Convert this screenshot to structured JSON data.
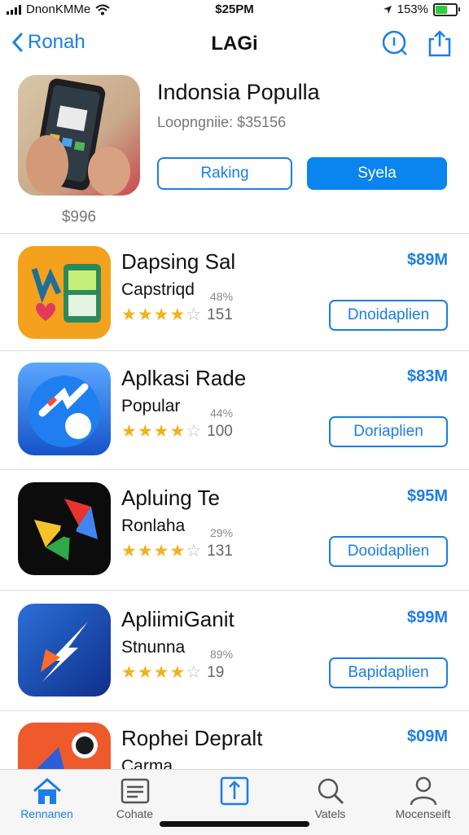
{
  "status": {
    "carrier": "DnonKMMe",
    "time": "$25PM",
    "battery": "153%"
  },
  "nav": {
    "back_label": "Ronah",
    "title": "LAGi"
  },
  "hero": {
    "title": "Indonsia Populla",
    "subtitle": "Loopngniie: $35156",
    "price": "$996",
    "outline_button": "Raking",
    "filled_button": "Syela"
  },
  "apps": [
    {
      "name": "Dapsing Sal",
      "category": "Capstriqd",
      "percent": "48%",
      "rating": 4.5,
      "count": "151",
      "price": "$89M",
      "button": "Dnoidaplien"
    },
    {
      "name": "Aplkasi Rade",
      "category": "Popular",
      "percent": "44%",
      "rating": 4.5,
      "count": "100",
      "price": "$83M",
      "button": "Doriaplien"
    },
    {
      "name": "Apluing Te",
      "category": "Ronlaha",
      "percent": "29%",
      "rating": 4.5,
      "count": "131",
      "price": "$95M",
      "button": "Dooidaplien"
    },
    {
      "name": "ApliimiGanit",
      "category": "Stnunna",
      "percent": "89%",
      "rating": 4.0,
      "count": "19",
      "price": "$99M",
      "button": "Bapidaplien"
    },
    {
      "name": "Rophei Depralt",
      "category": "Carma",
      "price": "$09M"
    }
  ],
  "tabs": [
    {
      "label": "Rennanen",
      "icon": "home-icon"
    },
    {
      "label": "Cohate",
      "icon": "list-icon"
    },
    {
      "label": "",
      "icon": "upload-icon"
    },
    {
      "label": "Vatels",
      "icon": "search-icon"
    },
    {
      "label": "Mocenseift",
      "icon": "person-icon"
    }
  ],
  "colors": {
    "accent": "#1a7ee8",
    "star": "#f3b21b"
  }
}
